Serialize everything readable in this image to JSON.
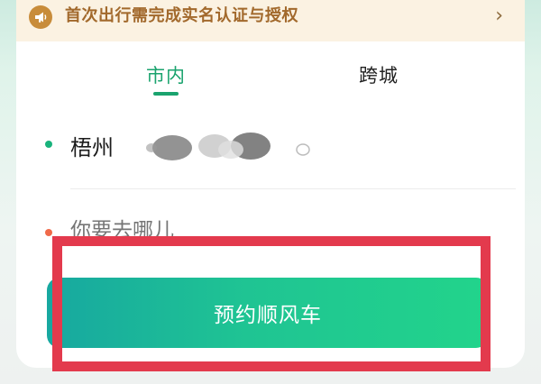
{
  "notice": {
    "icon": "megaphone-icon",
    "text": "首次出行需完成实名认证与授权",
    "chevron": "›"
  },
  "tabs": [
    {
      "label": "市内",
      "active": true
    },
    {
      "label": "跨城",
      "active": false
    }
  ],
  "origin": {
    "city": "梧州",
    "dot_color": "#19b37c"
  },
  "destination": {
    "placeholder": "你要去哪儿",
    "dot_color": "#f06a4a"
  },
  "book_button": {
    "label": "预约顺风车"
  },
  "colors": {
    "accent_green": "#1aa36e",
    "highlight_red": "#e33a4d",
    "notice_bg": "#fbf2e2",
    "notice_text": "#a2692c"
  }
}
